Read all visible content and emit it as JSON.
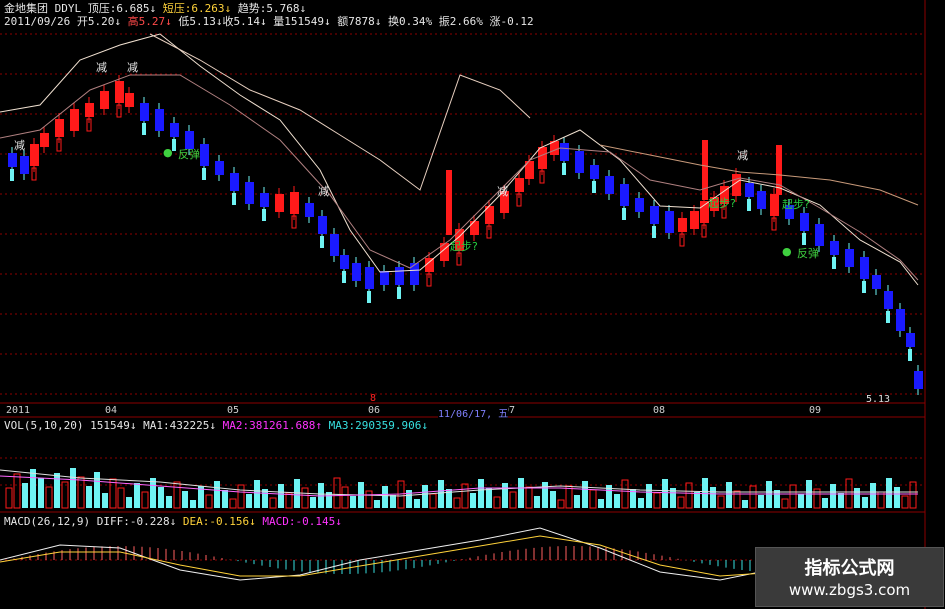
{
  "header": {
    "name": "金地集团",
    "indicator": "DDYL",
    "top_label": "顶压:",
    "top_value": "6.685",
    "short_label": "短压:",
    "short_value": "6.263",
    "trend_label": "趋势:",
    "trend_value": "5.768",
    "down_arrow": "↓",
    "up_arrow": "↑"
  },
  "quote": {
    "date": "2011/09/26",
    "open_label": "开",
    "open": "5.20",
    "high_label": "高",
    "high": "5.27",
    "low_label": "低",
    "low": "5.13",
    "close_label": "收",
    "close": "5.14",
    "vol_label": "量",
    "vol": "151549",
    "amt_label": "额",
    "amt": "7878",
    "turn_label": "换",
    "turn": "0.34%",
    "amp_label": "振",
    "amp": "2.66%",
    "chg_label": "涨",
    "chg": "-0.12"
  },
  "time_axis": {
    "labels": [
      "2011",
      "04",
      "05",
      "06",
      "07",
      "08",
      "09"
    ],
    "cursor_date": "11/06/17, 五",
    "marker": "8"
  },
  "last_price": "5.13",
  "annotations": {
    "reduce": "减",
    "rebound": "反弹",
    "start": "起步?"
  },
  "vol_panel": {
    "title": "VOL(5,10,20)",
    "value": "151549",
    "ma1_label": "MA1:",
    "ma1": "432225",
    "ma2_label": "MA2:",
    "ma2": "381261.688",
    "ma3_label": "MA3:",
    "ma3": "290359.906"
  },
  "macd_panel": {
    "title": "MACD(26,12,9)",
    "diff_label": "DIFF:",
    "diff": "-0.228",
    "dea_label": "DEA:",
    "dea": "-0.156",
    "macd_label": "MACD:",
    "macd": "-0.145"
  },
  "watermark": {
    "title": "指标公式网",
    "url": "www.zbgs3.com"
  },
  "colors": {
    "background": "#000000",
    "up_candle": "#ff1a1a",
    "down_candle": "#1a1aff",
    "cyan_candle": "#6ff3f3",
    "gridline": "#8b0000",
    "curve": "#f0e0d0"
  }
}
